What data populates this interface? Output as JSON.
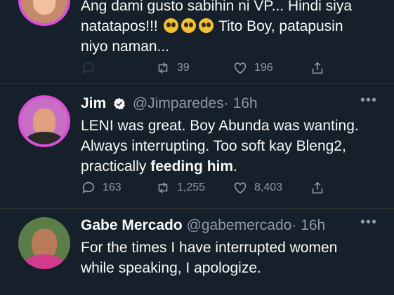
{
  "tweets": [
    {
      "text_line1": "Ang dami gusto sabihin ni VP... Hindi siya",
      "text_line2a": "natatapos!!!",
      "text_line2b": "Tito Boy, patapusin",
      "text_line3": "niyo naman...",
      "emoji": "pleading-face",
      "replies": "",
      "retweets": "39",
      "likes": "196"
    },
    {
      "name": "Jim",
      "handle": "@Jimparedes",
      "time": "· 16h",
      "verified": true,
      "text_line1": "LENI was great. Boy Abunda was wanting.",
      "text_line2": "Always interrupting. Too soft kay Bleng2,",
      "text_line3a": "practically",
      "text_line3b": "feeding him",
      "text_line3c": ".",
      "replies": "163",
      "retweets": "1,255",
      "likes": "8,403"
    },
    {
      "name": "Gabe Mercado",
      "handle": "@gabemercado",
      "time": "· 16h",
      "text_line1": "For the times I have interrupted women",
      "text_line2": "while speaking, I apologize."
    }
  ],
  "colors": {
    "background": "#15202b",
    "text": "#f7f9f9",
    "muted": "#8b98a5",
    "verified": "#1d9bf0",
    "ring": "#d94fd6"
  }
}
